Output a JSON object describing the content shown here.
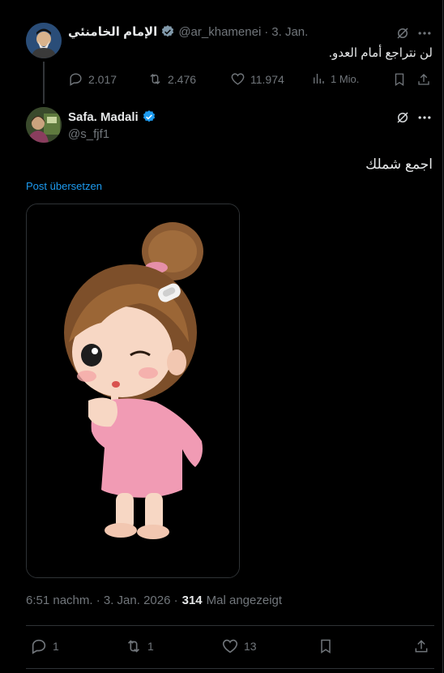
{
  "quoted_post": {
    "display_name": "الإمام الخامنئي",
    "handle": "@ar_khamenei",
    "separator": "·",
    "date": "3. Jan.",
    "text": "لن نتراجع أمام العدو.",
    "stats": {
      "replies": "2.017",
      "reposts": "2.476",
      "likes": "11.974",
      "views": "1 Mio."
    }
  },
  "main_post": {
    "display_name": "Safa. Madali",
    "handle": "@s_fjf1",
    "text": "اجمع شملك",
    "translate_label": "Post übersetzen",
    "timestamp": "6:51 nachm. · 3. Jan. 2026 ·",
    "view_count": "314",
    "view_label": "Mal angezeigt",
    "stats": {
      "replies": "1",
      "reposts": "1",
      "likes": "13"
    }
  },
  "colors": {
    "background": "#000000",
    "text": "#e7e9ea",
    "muted": "#71767b",
    "accent": "#1d9bf0",
    "border": "#2f3336"
  },
  "icons": {
    "verified": "verified-badge-icon",
    "grok": "grok-icon",
    "more": "more-icon",
    "reply": "reply-icon",
    "repost": "repost-icon",
    "like": "heart-icon",
    "views": "views-icon",
    "bookmark": "bookmark-icon",
    "share": "share-icon"
  }
}
